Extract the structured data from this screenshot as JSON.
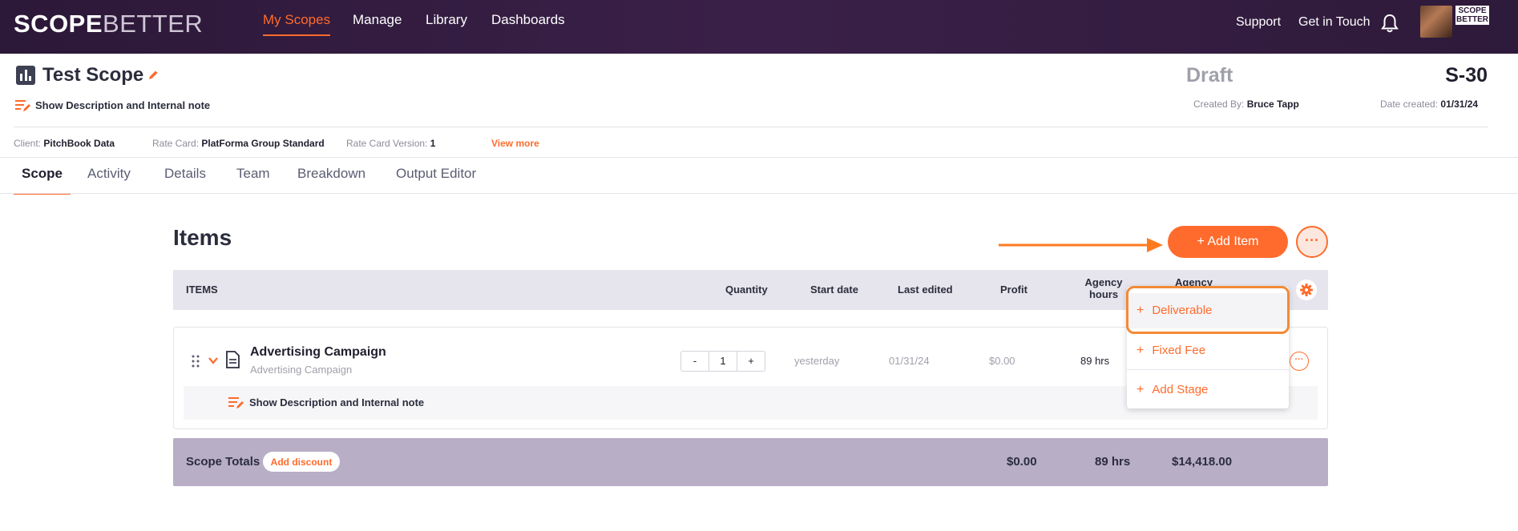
{
  "nav": {
    "logo_scope": "SCOPE",
    "logo_better": "BETTER",
    "items": [
      "My Scopes",
      "Manage",
      "Library",
      "Dashboards"
    ],
    "active": "My Scopes",
    "support": "Support",
    "get_in_touch": "Get in Touch",
    "avatar_badge_top": "SCOPE",
    "avatar_badge_bottom": "BETTER"
  },
  "scope": {
    "title": "Test Scope",
    "show_description": "Show Description and Internal note",
    "status": "Draft",
    "id": "S-30",
    "created_by_label": "Created By:",
    "created_by": "Bruce Tapp",
    "date_created_label": "Date created:",
    "date_created": "01/31/24",
    "client_label": "Client:",
    "client": "PitchBook Data",
    "rate_card_label": "Rate Card:",
    "rate_card": "PlatForma Group Standard",
    "rate_card_version_label": "Rate Card Version:",
    "rate_card_version": "1",
    "view_more": "View more"
  },
  "tabs": [
    "Scope",
    "Activity",
    "Details",
    "Team",
    "Breakdown",
    "Output Editor"
  ],
  "items_section": {
    "title": "Items",
    "add_item": "+ Add Item",
    "more": "···",
    "columns": [
      "ITEMS",
      "Quantity",
      "Start date",
      "Last edited",
      "Profit",
      "Agency hours",
      "Agency"
    ],
    "rows": [
      {
        "title": "Advertising Campaign",
        "subtitle": "Advertising Campaign",
        "quantity": "1",
        "minus": "-",
        "plus": "+",
        "start_date": "yesterday",
        "last_edited": "01/31/24",
        "profit": "$0.00",
        "agency_hours": "89 hrs",
        "show_description": "Show Description and Internal note"
      }
    ],
    "totals": {
      "label": "Scope Totals",
      "add_discount": "Add discount",
      "profit": "$0.00",
      "hours": "89 hrs",
      "price": "$14,418.00"
    }
  },
  "add_menu": {
    "items": [
      "Deliverable",
      "Fixed Fee",
      "Add Stage"
    ]
  },
  "colors": {
    "accent": "#ff6b2c",
    "nav_bg": "#2c1838",
    "totals_bg": "#b8aec6",
    "highlight": "#f28a36"
  }
}
